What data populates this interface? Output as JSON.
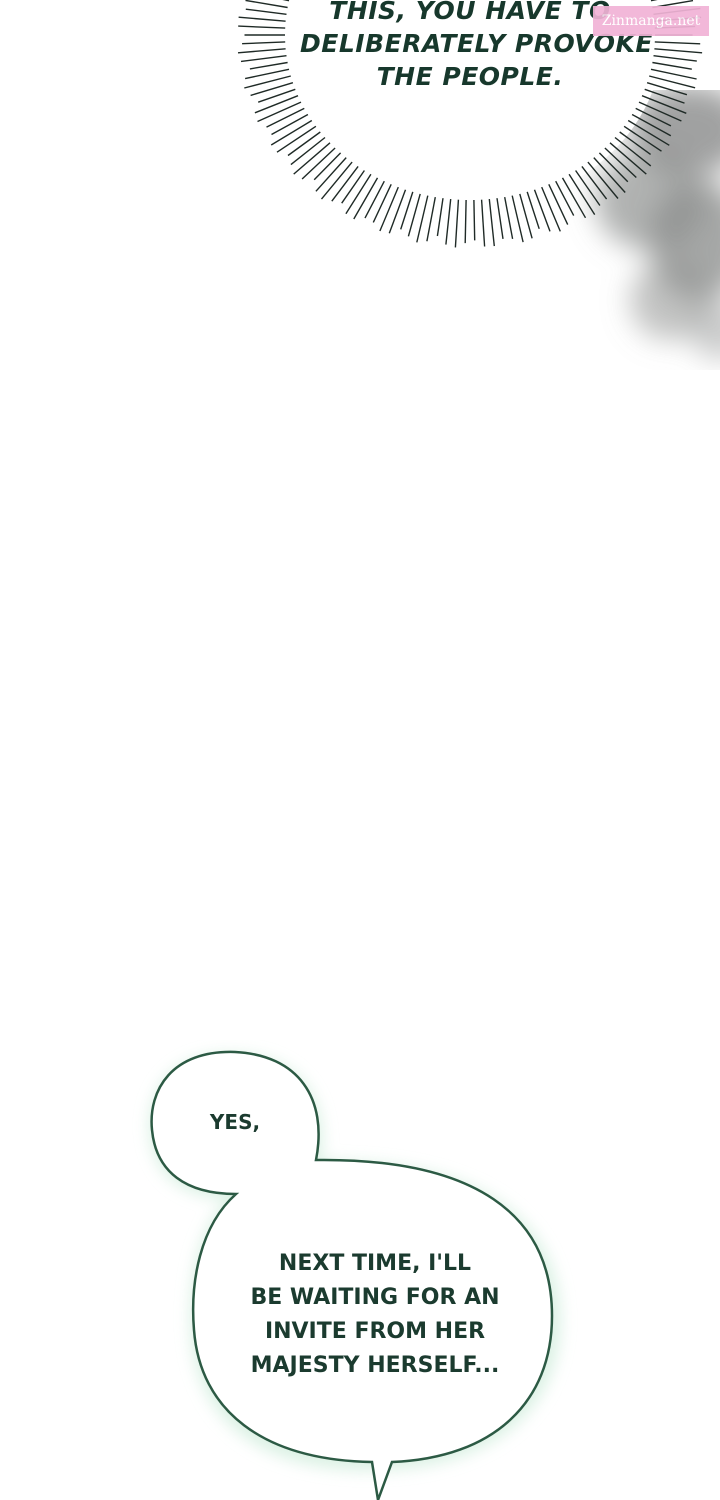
{
  "top_bubble": {
    "lines": [
      "THIS, YOU HAVE TO",
      "DELIBERATELY PROVOKE",
      "THE PEOPLE."
    ]
  },
  "watermark": {
    "text": "Zinmanga.net"
  },
  "bottom_bubble": {
    "small_text": "YES,",
    "large_lines": [
      "NEXT TIME, I'LL",
      "BE WAITING FOR AN",
      "INVITE FROM HER",
      "MAJESTY HERSELF..."
    ]
  },
  "colors": {
    "text": "#17382c",
    "bubble_outline": "#2c5a44",
    "bubble_glow": "#d6efe0",
    "burst_lines": "#1f2a26",
    "watermark_bg": "#f1b3d6"
  }
}
